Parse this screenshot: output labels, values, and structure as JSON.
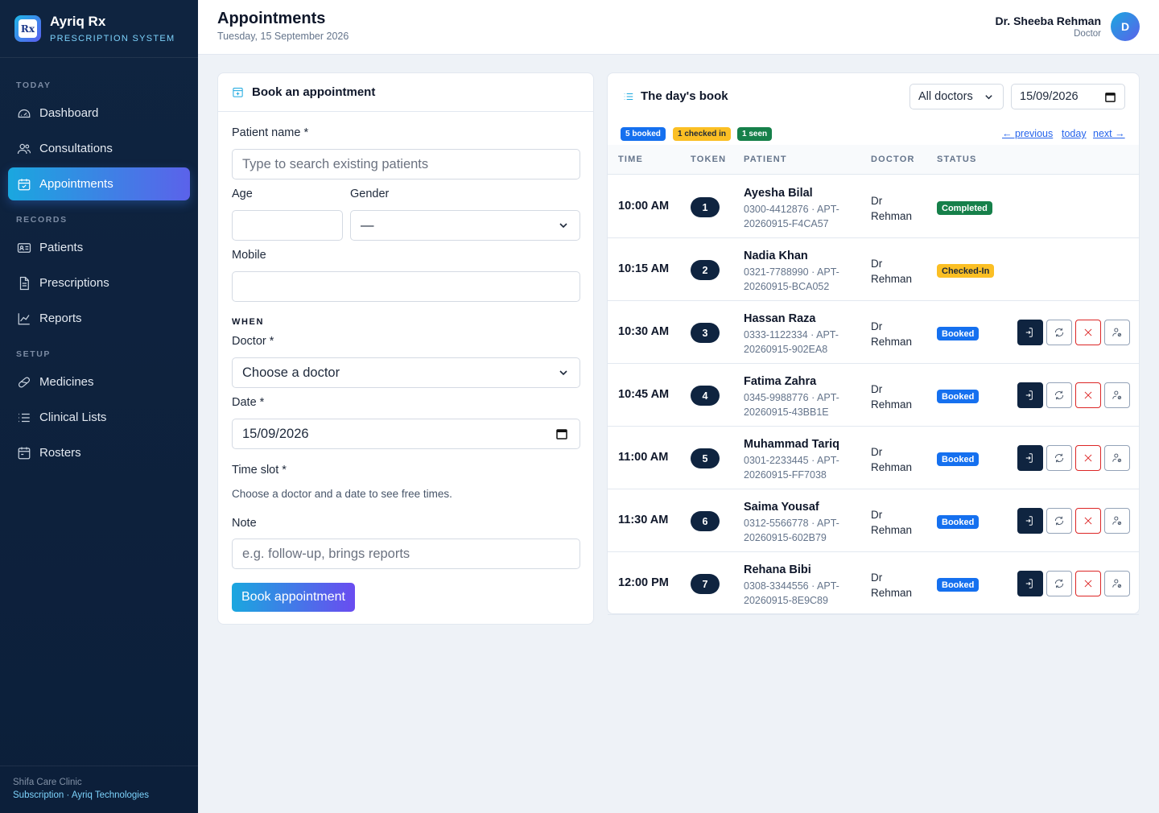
{
  "brand": {
    "name": "Ayriq Rx",
    "subtitle": "PRESCRIPTION SYSTEM",
    "logo_text": "Rx"
  },
  "nav": {
    "sections": [
      "TODAY",
      "RECORDS",
      "SETUP"
    ],
    "items": [
      {
        "label": "Dashboard",
        "icon": "gauge-icon"
      },
      {
        "label": "Consultations",
        "icon": "users-icon"
      },
      {
        "label": "Appointments",
        "icon": "calendar-icon",
        "active": true
      },
      {
        "label": "Patients",
        "icon": "id-card-icon"
      },
      {
        "label": "Prescriptions",
        "icon": "document-icon"
      },
      {
        "label": "Reports",
        "icon": "chart-icon"
      },
      {
        "label": "Medicines",
        "icon": "pill-icon"
      },
      {
        "label": "Clinical Lists",
        "icon": "list-icon"
      },
      {
        "label": "Rosters",
        "icon": "roster-icon"
      }
    ]
  },
  "footer": {
    "clinic": "Shifa Care Clinic",
    "subscription": "Subscription",
    "separator": " · ",
    "vendor": "Ayriq Technologies"
  },
  "header": {
    "title": "Appointments",
    "date": "Tuesday, 15 September 2026",
    "user_name": "Dr. Sheeba Rehman",
    "user_role": "Doctor",
    "avatar_initial": "D"
  },
  "booking": {
    "title": "Book an appointment",
    "patient_label": "Patient name *",
    "patient_placeholder": "Type to search existing patients",
    "age_label": "Age",
    "gender_label": "Gender",
    "gender_value": "—",
    "mobile_label": "Mobile",
    "when_label": "WHEN",
    "doctor_label": "Doctor *",
    "doctor_value": "Choose a doctor",
    "date_label": "Date *",
    "date_value": "15/09/2026",
    "slot_label": "Time slot *",
    "slot_hint": "Choose a doctor and a date to see free times.",
    "note_label": "Note",
    "note_placeholder": "e.g. follow-up, brings reports",
    "submit_label": "Book appointment"
  },
  "daybook": {
    "title": "The day's book",
    "doctor_filter": "All doctors",
    "date": "15/09/2026",
    "summary": {
      "booked": "5 booked",
      "checked_in": "1 checked in",
      "seen": "1 seen"
    },
    "pager": {
      "previous": "← previous",
      "today": "today",
      "next": "next →"
    },
    "columns": [
      "TIME",
      "TOKEN",
      "PATIENT",
      "DOCTOR",
      "STATUS"
    ],
    "rows": [
      {
        "time": "10:00 AM",
        "token": "1",
        "name": "Ayesha Bilal",
        "meta": "0300-4412876 · APT-20260915-F4CA57",
        "doctor": "Dr Rehman",
        "status": "Completed"
      },
      {
        "time": "10:15 AM",
        "token": "2",
        "name": "Nadia Khan",
        "meta": "0321-7788990 · APT-20260915-BCA052",
        "doctor": "Dr Rehman",
        "status": "Checked-In"
      },
      {
        "time": "10:30 AM",
        "token": "3",
        "name": "Hassan Raza",
        "meta": "0333-1122334 · APT-20260915-902EA8",
        "doctor": "Dr Rehman",
        "status": "Booked"
      },
      {
        "time": "10:45 AM",
        "token": "4",
        "name": "Fatima Zahra",
        "meta": "0345-9988776 · APT-20260915-43BB1E",
        "doctor": "Dr Rehman",
        "status": "Booked"
      },
      {
        "time": "11:00 AM",
        "token": "5",
        "name": "Muhammad Tariq",
        "meta": "0301-2233445 · APT-20260915-FF7038",
        "doctor": "Dr Rehman",
        "status": "Booked"
      },
      {
        "time": "11:30 AM",
        "token": "6",
        "name": "Saima Yousaf",
        "meta": "0312-5566778 · APT-20260915-602B79",
        "doctor": "Dr Rehman",
        "status": "Booked"
      },
      {
        "time": "12:00 PM",
        "token": "7",
        "name": "Rehana Bibi",
        "meta": "0308-3344556 · APT-20260915-8E9C89",
        "doctor": "Dr Rehman",
        "status": "Booked"
      }
    ]
  },
  "colors": {
    "sidebar": "#0f2440",
    "accent_start": "#1aa7df",
    "accent_end": "#5b62ea",
    "booked": "#1570ef",
    "checked_in": "#fbbf24",
    "completed": "#16804a",
    "cancel": "#dc2626"
  }
}
